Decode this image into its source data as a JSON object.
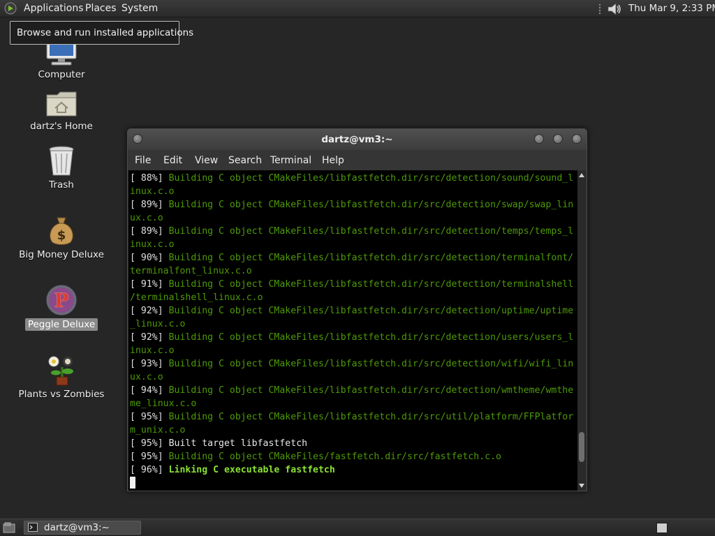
{
  "top_panel": {
    "menus": {
      "applications": "Applications",
      "places": "Places",
      "system": "System"
    },
    "clock": "Thu Mar  9,  2:33 PM"
  },
  "tooltip": "Browse and run installed applications",
  "desktop_icons": {
    "computer": "Computer",
    "home": "dartz's Home",
    "trash": "Trash",
    "big_money": "Big Money Deluxe",
    "peggle": "Peggle Deluxe",
    "pvz": "Plants vs Zombies"
  },
  "terminal": {
    "title": "dartz@vm3:~",
    "menu": {
      "file": "File",
      "edit": "Edit",
      "view": "View",
      "search": "Search",
      "terminal": "Terminal",
      "help": "Help"
    },
    "lines": [
      {
        "pct": "[ 88%] ",
        "msg": "Building C object CMakeFiles/libfastfetch.dir/src/detection/sound/sound_l",
        "style": "green"
      },
      {
        "pct": "",
        "msg": "inux.c.o",
        "style": "green"
      },
      {
        "pct": "[ 89%] ",
        "msg": "Building C object CMakeFiles/libfastfetch.dir/src/detection/swap/swap_lin",
        "style": "green"
      },
      {
        "pct": "",
        "msg": "ux.c.o",
        "style": "green"
      },
      {
        "pct": "[ 89%] ",
        "msg": "Building C object CMakeFiles/libfastfetch.dir/src/detection/temps/temps_l",
        "style": "green"
      },
      {
        "pct": "",
        "msg": "inux.c.o",
        "style": "green"
      },
      {
        "pct": "[ 90%] ",
        "msg": "Building C object CMakeFiles/libfastfetch.dir/src/detection/terminalfont/",
        "style": "green"
      },
      {
        "pct": "",
        "msg": "terminalfont_linux.c.o",
        "style": "green"
      },
      {
        "pct": "[ 91%] ",
        "msg": "Building C object CMakeFiles/libfastfetch.dir/src/detection/terminalshell",
        "style": "green"
      },
      {
        "pct": "",
        "msg": "/terminalshell_linux.c.o",
        "style": "green"
      },
      {
        "pct": "[ 92%] ",
        "msg": "Building C object CMakeFiles/libfastfetch.dir/src/detection/uptime/uptime",
        "style": "green"
      },
      {
        "pct": "",
        "msg": "_linux.c.o",
        "style": "green"
      },
      {
        "pct": "[ 92%] ",
        "msg": "Building C object CMakeFiles/libfastfetch.dir/src/detection/users/users_l",
        "style": "green"
      },
      {
        "pct": "",
        "msg": "inux.c.o",
        "style": "green"
      },
      {
        "pct": "[ 93%] ",
        "msg": "Building C object CMakeFiles/libfastfetch.dir/src/detection/wifi/wifi_lin",
        "style": "green"
      },
      {
        "pct": "",
        "msg": "ux.c.o",
        "style": "green"
      },
      {
        "pct": "[ 94%] ",
        "msg": "Building C object CMakeFiles/libfastfetch.dir/src/detection/wmtheme/wmthe",
        "style": "green"
      },
      {
        "pct": "",
        "msg": "me_linux.c.o",
        "style": "green"
      },
      {
        "pct": "[ 95%] ",
        "msg": "Building C object CMakeFiles/libfastfetch.dir/src/util/platform/FFPlatfor",
        "style": "green"
      },
      {
        "pct": "",
        "msg": "m_unix.c.o",
        "style": "green"
      },
      {
        "pct": "[ 95%] ",
        "msg": "Built target libfastfetch",
        "style": "white"
      },
      {
        "pct": "[ 95%] ",
        "msg": "Building C object CMakeFiles/fastfetch.dir/src/fastfetch.c.o",
        "style": "green"
      },
      {
        "pct": "[ 96%] ",
        "msg": "Linking C executable fastfetch",
        "style": "bold"
      }
    ],
    "scroll_position": 0.93,
    "scroll_visible_fraction": 0.1
  },
  "taskbar": {
    "task_label": "dartz@vm3:~"
  },
  "icons": {
    "logo": "gnome-foot-icon",
    "volume": "speaker-icon",
    "terminal_task": "terminal-icon",
    "show_desktop": "show-desktop-icon"
  }
}
